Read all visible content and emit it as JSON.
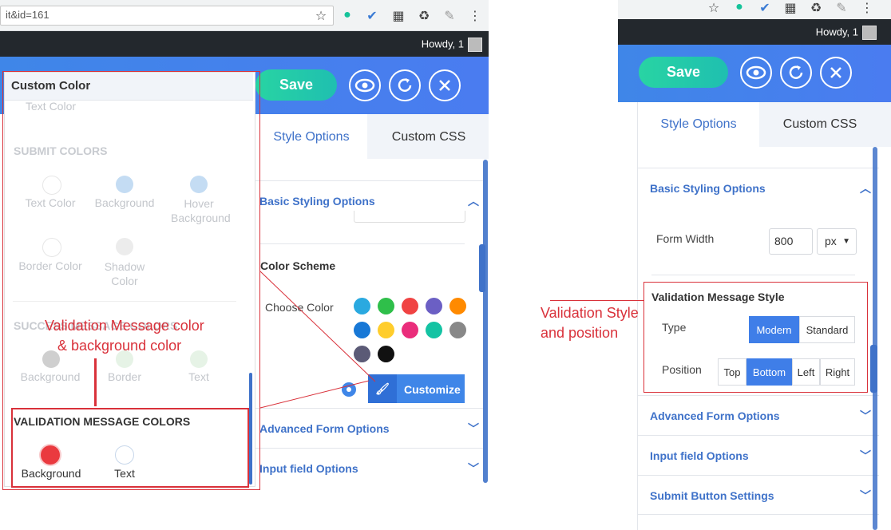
{
  "left": {
    "url": "it&id=161",
    "howdy": "Howdy, 1",
    "save_label": "Save",
    "tabs": [
      "Style Options",
      "Custom CSS"
    ],
    "accordions": [
      "Basic Styling Options",
      "Advanced Form Options",
      "Input field Options"
    ],
    "color_scheme_title": "Color Scheme",
    "choose_color_label": "Choose Color",
    "customize_label": "Customize",
    "swatches": [
      "#2aa9e0",
      "#2fbf4a",
      "#f04343",
      "#6b5fc4",
      "#ff8a00",
      "#1878d6",
      "#ffcd2c",
      "#ea2d7b",
      "#14c3a3",
      "#888888",
      "#5b5a76",
      "#111111"
    ],
    "panel": {
      "title": "Custom Color",
      "text_color_hint": "Text Color",
      "submit_title": "SUBMIT COLORS",
      "submit_items": [
        "Text Color",
        "Background",
        "Hover Background",
        "Border Color",
        "Shadow Color"
      ],
      "success_title": "SUCCESS MESSAGE COLORS",
      "success_items": [
        "Background",
        "Border",
        "Text"
      ],
      "validation_title": "VALIDATION MESSAGE COLORS",
      "validation_items": [
        "Background",
        "Text"
      ]
    },
    "annotation": [
      "Validation Message color",
      "& background color"
    ]
  },
  "right": {
    "howdy": "Howdy, 1",
    "save_label": "Save",
    "tabs": [
      "Style Options",
      "Custom CSS"
    ],
    "basic_title": "Basic Styling Options",
    "form_width_label": "Form Width",
    "form_width_value": "800",
    "unit": "px",
    "validation_title": "Validation Message Style",
    "type_label": "Type",
    "type_options": [
      "Modern",
      "Standard"
    ],
    "position_label": "Position",
    "position_options": [
      "Top",
      "Bottom",
      "Left",
      "Right"
    ],
    "accordions": [
      "Advanced Form Options",
      "Input field Options",
      "Submit Button Settings"
    ],
    "annotation": [
      "Validation Style",
      "and position"
    ]
  },
  "colors": {
    "accent": "#3f72c9",
    "brand_blue": "#4a7cf0",
    "save_green": "#22c9aa",
    "annotation_red": "#d9313a",
    "validation_red": "#ea3a3f"
  }
}
